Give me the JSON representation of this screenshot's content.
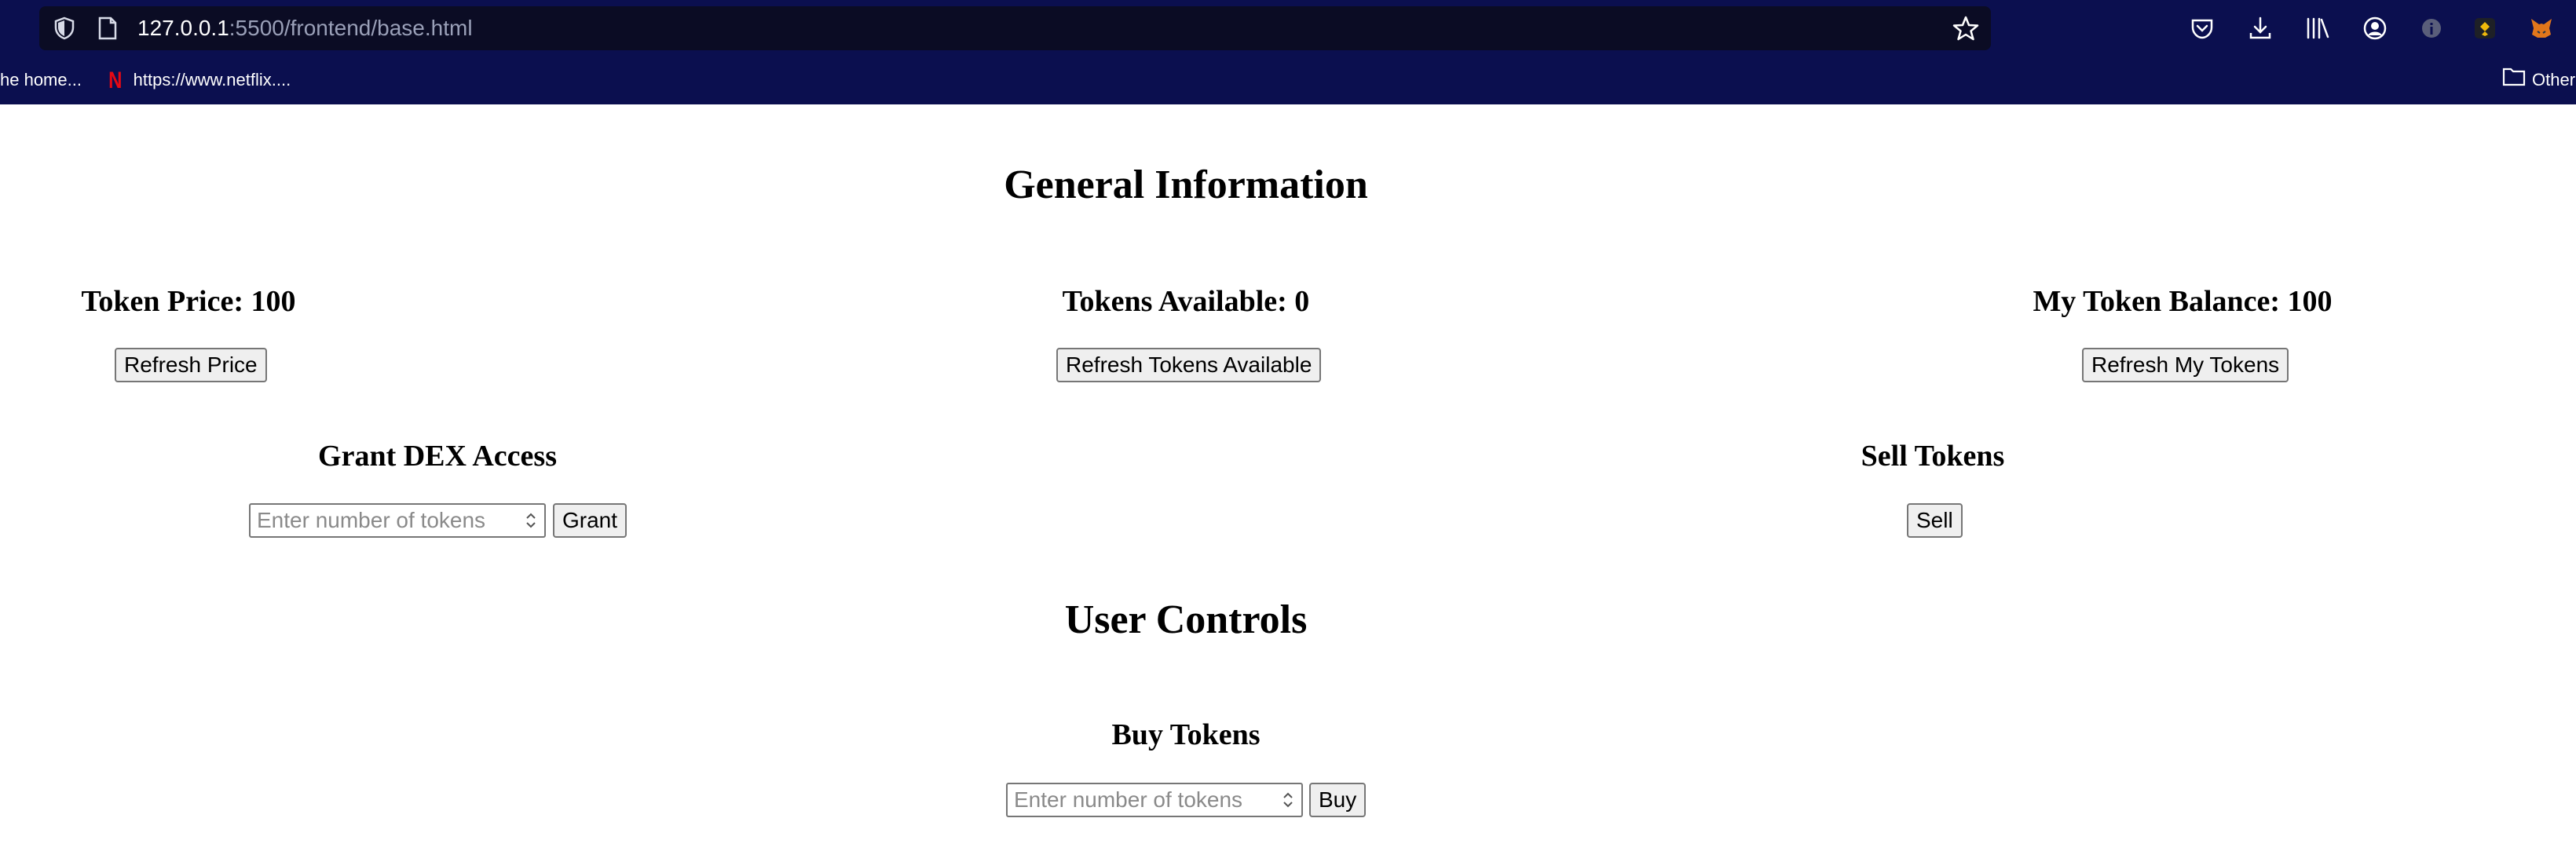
{
  "browser": {
    "url_host": "127.0.0.1",
    "url_rest": ":5500/frontend/base.html",
    "bookmarks": [
      {
        "label": "he home..."
      },
      {
        "label": "https://www.netflix...."
      }
    ],
    "other_bookmarks_label": "Other",
    "colors": {
      "toolbar": "#0b0f4f",
      "urlbar": "#0b0c24"
    }
  },
  "general": {
    "title": "General Information",
    "token_price": "Token Price: 100",
    "refresh_price": "Refresh Price",
    "tokens_available": "Tokens Available: 0",
    "refresh_tokens_available": "Refresh Tokens Available",
    "my_token_balance": "My Token Balance: 100",
    "refresh_my_tokens": "Refresh My Tokens",
    "grant_title": "Grant DEX Access",
    "grant_placeholder": "Enter number of tokens",
    "grant_button": "Grant",
    "sell_title": "Sell Tokens",
    "sell_button": "Sell"
  },
  "user": {
    "title": "User Controls",
    "buy_title": "Buy Tokens",
    "buy_placeholder": "Enter number of tokens",
    "buy_button": "Buy"
  }
}
